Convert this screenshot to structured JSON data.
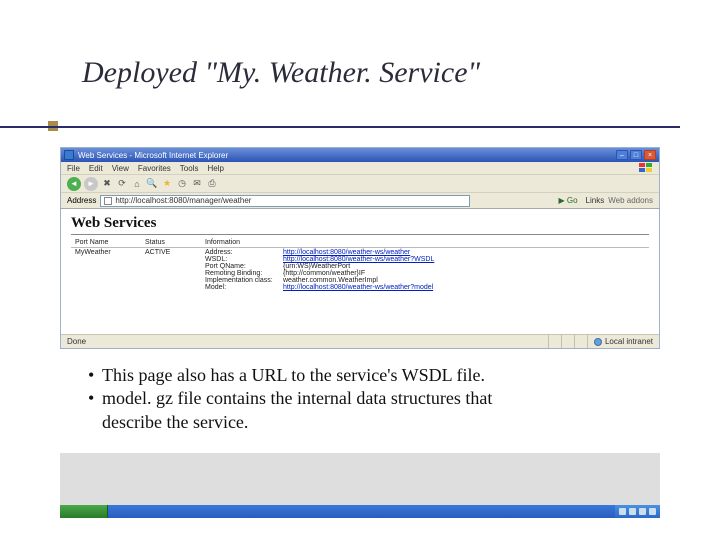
{
  "slide": {
    "title": "Deployed \"My. Weather. Service\""
  },
  "browser": {
    "window_title": "Web Services - Microsoft Internet Explorer",
    "menus": {
      "file": "File",
      "edit": "Edit",
      "view": "View",
      "favorites": "Favorites",
      "tools": "Tools",
      "help": "Help"
    },
    "address_label": "Address",
    "address_value": "http://localhost:8080/manager/weather",
    "go_label": "Go",
    "links_label": "Links",
    "webaddons_label": "Web addons",
    "status_done": "Done",
    "status_zone": "Local intranet"
  },
  "page": {
    "heading": "Web Services",
    "columns": {
      "port": "Port Name",
      "status": "Status",
      "info": "Information"
    },
    "row": {
      "port_name": "MyWeather",
      "status": "ACTIVE",
      "info": [
        {
          "key": "Address:",
          "value": "http://localhost:8080/weather-ws/weather",
          "link": true
        },
        {
          "key": "WSDL:",
          "value": "http://localhost:8080/weather-ws/weather?WSDL",
          "link": true
        },
        {
          "key": "Port QName:",
          "value": "{urn:WS}WeatherPort",
          "link": false
        },
        {
          "key": "Remoting Binding:",
          "value": "{http://common/weather}IF",
          "link": false
        },
        {
          "key": "Implementation class:",
          "value": "weather.common.WeatherImpl",
          "link": false
        },
        {
          "key": "Model:",
          "value": "http://localhost:8080/weather-ws/weather?model",
          "link": true
        }
      ]
    }
  },
  "bullets": {
    "b1": "This page also has a URL to the service's WSDL file.",
    "b2a": "model. gz file contains the internal data structures that",
    "b2b": "describe the service."
  }
}
